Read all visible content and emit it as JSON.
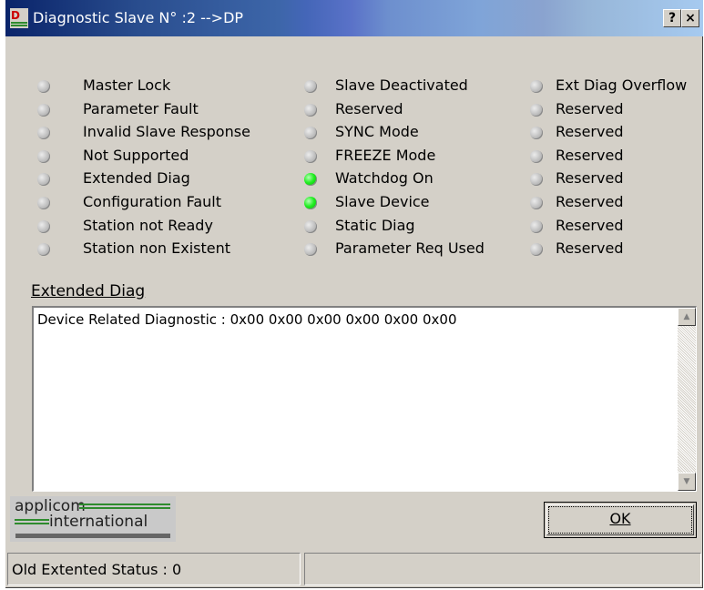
{
  "window": {
    "title": "Diagnostic Slave N° :2 -->DP",
    "help_label": "?",
    "close_label": "×"
  },
  "status_flags": {
    "column1": [
      {
        "label": "Master Lock",
        "on": false
      },
      {
        "label": "Parameter Fault",
        "on": false
      },
      {
        "label": "Invalid Slave Response",
        "on": false
      },
      {
        "label": "Not Supported",
        "on": false
      },
      {
        "label": "Extended Diag",
        "on": false
      },
      {
        "label": "Configuration Fault",
        "on": false
      },
      {
        "label": "Station not Ready",
        "on": false
      },
      {
        "label": "Station non Existent",
        "on": false
      }
    ],
    "column2": [
      {
        "label": "Slave Deactivated",
        "on": false
      },
      {
        "label": "Reserved",
        "on": false
      },
      {
        "label": "SYNC Mode",
        "on": false
      },
      {
        "label": "FREEZE Mode",
        "on": false
      },
      {
        "label": "Watchdog On",
        "on": true
      },
      {
        "label": "Slave Device",
        "on": true
      },
      {
        "label": "Static Diag",
        "on": false
      },
      {
        "label": "Parameter Req Used",
        "on": false
      }
    ],
    "column3": [
      {
        "label": "Ext Diag Overflow",
        "on": false
      },
      {
        "label": "Reserved",
        "on": false
      },
      {
        "label": "Reserved",
        "on": false
      },
      {
        "label": "Reserved",
        "on": false
      },
      {
        "label": "Reserved",
        "on": false
      },
      {
        "label": "Reserved",
        "on": false
      },
      {
        "label": "Reserved",
        "on": false
      },
      {
        "label": "Reserved",
        "on": false
      }
    ]
  },
  "extended_diag": {
    "title": "Extended Diag",
    "text": "Device Related Diagnostic : 0x00 0x00 0x00 0x00 0x00 0x00"
  },
  "logo": {
    "line1": "applicom",
    "line2": "international"
  },
  "ok_label": "OK",
  "status_bar": {
    "left_text": "Old Extented Status : 0",
    "right_text": ""
  },
  "colors": {
    "led_on": "#22ee22",
    "led_off": "#bdbdbd",
    "face": "#d4d0c8"
  }
}
